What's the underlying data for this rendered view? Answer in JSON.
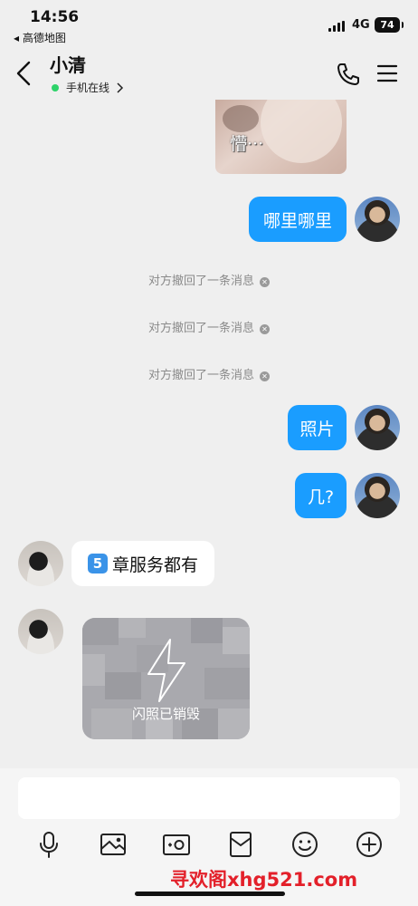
{
  "status_bar": {
    "time": "14:56",
    "back_app": "◂ 高德地图",
    "network": "4G",
    "battery": "74"
  },
  "header": {
    "title": "小清",
    "online_status": "手机在线"
  },
  "messages": {
    "sticker_text": "懵···",
    "out_1": "哪里哪里",
    "system_1": "对方撤回了一条消息",
    "system_2": "对方撤回了一条消息",
    "system_3": "对方撤回了一条消息",
    "out_2": "照片",
    "out_3": "几?",
    "in_1_emoji": "5",
    "in_1_text": "章服务都有",
    "flash_label": "闪照已销毁"
  },
  "input": {
    "value": ""
  },
  "toolbar": {
    "icons": [
      "mic-icon",
      "image-icon",
      "camera-icon",
      "red-packet-icon",
      "emoji-icon",
      "plus-icon"
    ]
  },
  "watermark": "寻欢阁xhg521.com",
  "colors": {
    "bubble_out": "#1a9dff",
    "bubble_in": "#ffffff",
    "background": "#efefef",
    "watermark": "#e3202a"
  }
}
